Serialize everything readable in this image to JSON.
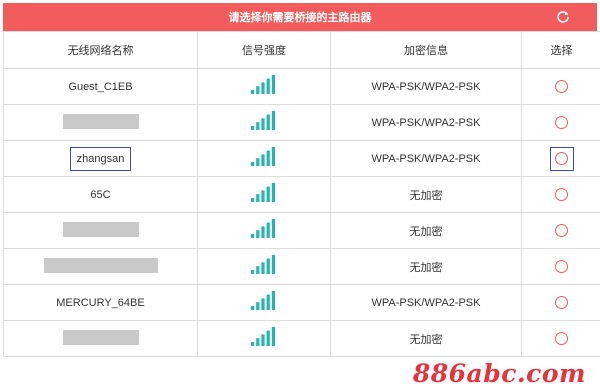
{
  "header": {
    "title": "请选择你需要桥接的主路由器",
    "refresh_icon": "refresh-icon"
  },
  "columns": [
    "无线网络名称",
    "信号强度",
    "加密信息",
    "选择"
  ],
  "colors": {
    "accent": "#f25c5c",
    "focus": "#3d4ea0",
    "signal": "#27b3b0",
    "redacted": "#c9c9c9"
  },
  "rows": [
    {
      "ssid": "Guest_C1EB",
      "redacted": false,
      "signal_bars": 5,
      "security": "WPA-PSK/WPA2-PSK",
      "focused": false
    },
    {
      "ssid": "",
      "redacted": true,
      "redaction_width": 76,
      "signal_bars": 5,
      "security": "WPA-PSK/WPA2-PSK",
      "focused": false
    },
    {
      "ssid": "zhangsan",
      "redacted": false,
      "signal_bars": 5,
      "security": "WPA-PSK/WPA2-PSK",
      "focused": true,
      "editing": true
    },
    {
      "ssid": "65C",
      "redacted": false,
      "signal_bars": 5,
      "security": "无加密",
      "focused": false
    },
    {
      "ssid": "",
      "redacted": true,
      "redaction_width": 76,
      "signal_bars": 5,
      "security": "无加密",
      "focused": false
    },
    {
      "ssid": "",
      "redacted": true,
      "redaction_width": 114,
      "signal_bars": 5,
      "security": "无加密",
      "focused": false
    },
    {
      "ssid": "MERCURY_64BE",
      "redacted": false,
      "signal_bars": 5,
      "security": "WPA-PSK/WPA2-PSK",
      "focused": false
    },
    {
      "ssid": "",
      "redacted": true,
      "redaction_width": 76,
      "signal_bars": 5,
      "security": "无加密",
      "focused": false
    }
  ],
  "watermark": "886abc.com"
}
